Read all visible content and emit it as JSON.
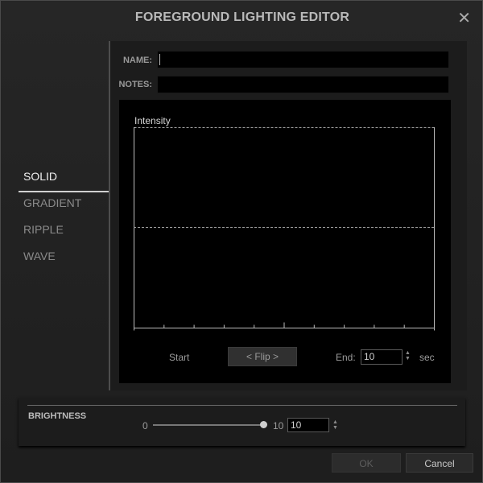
{
  "dialog": {
    "title": "FOREGROUND LIGHTING EDITOR",
    "close_icon": "close-icon"
  },
  "tabs": [
    {
      "label": "SOLID",
      "active": true
    },
    {
      "label": "GRADIENT",
      "active": false
    },
    {
      "label": "RIPPLE",
      "active": false
    },
    {
      "label": "WAVE",
      "active": false
    }
  ],
  "form": {
    "name_label": "NAME:",
    "name_value": "",
    "notes_label": "NOTES:",
    "notes_value": ""
  },
  "graph": {
    "label": "Intensity",
    "level": 0.5
  },
  "controls": {
    "start_label": "Start",
    "flip_label": "< Flip >",
    "end_label": "End:",
    "end_value": "10",
    "unit_label": "sec"
  },
  "brightness": {
    "label": "BRIGHTNESS",
    "min_label": "0",
    "max_label": "10",
    "value": "10"
  },
  "buttons": {
    "ok_label": "OK",
    "cancel_label": "Cancel"
  },
  "colors": {
    "background": "#1e1e1e",
    "panel": "#1c1c1c",
    "active_text": "#ededed",
    "inactive_text": "#8a8a8a"
  }
}
